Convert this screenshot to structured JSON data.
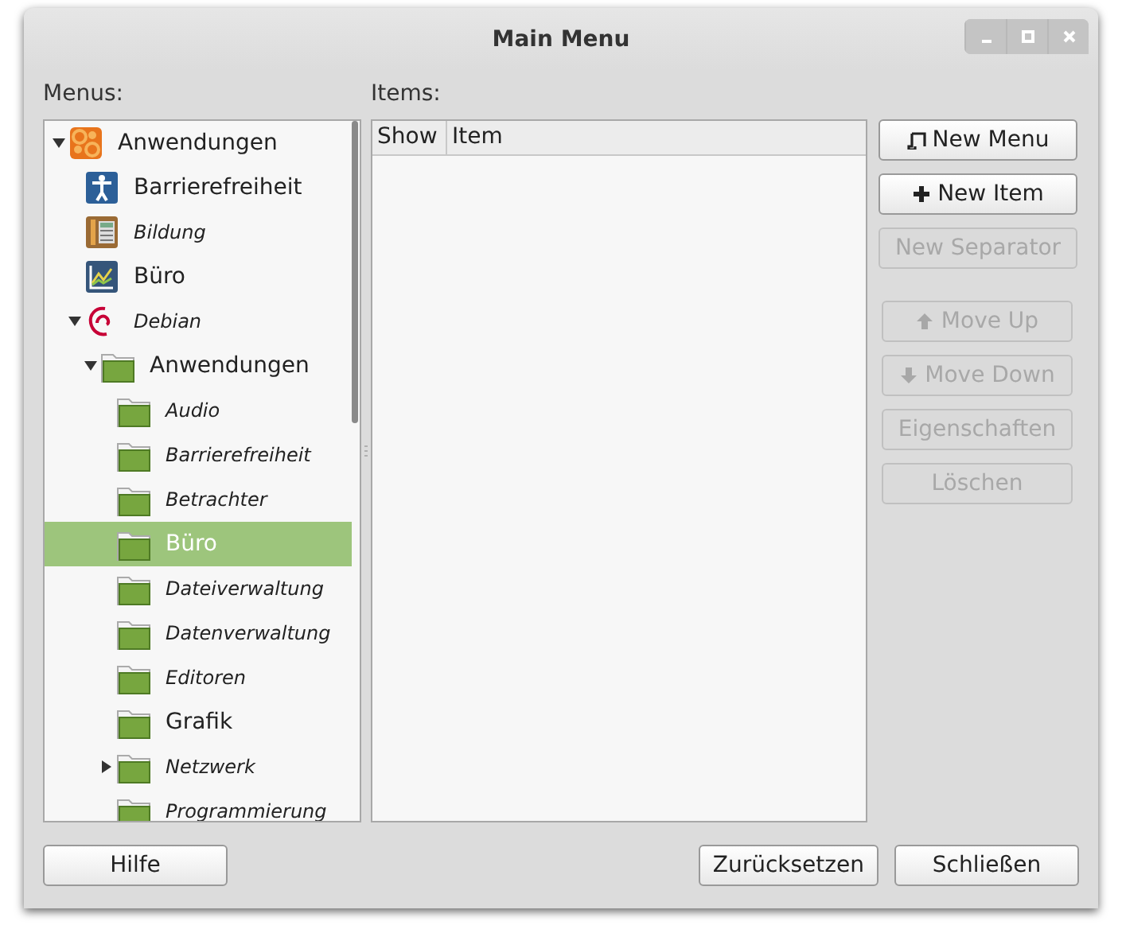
{
  "window": {
    "title": "Main Menu"
  },
  "menus": {
    "label": "Menus:",
    "tree": [
      {
        "label": "Anwendungen",
        "kind": "applications",
        "empty": false,
        "selected": false,
        "expanded": true,
        "children": [
          {
            "label": "Barrierefreiheit",
            "kind": "accessibility",
            "empty": false,
            "selected": false
          },
          {
            "label": "Bildung",
            "kind": "education",
            "empty": true,
            "selected": false
          },
          {
            "label": "Büro",
            "kind": "office",
            "empty": false,
            "selected": false
          },
          {
            "label": "Debian",
            "kind": "debian",
            "empty": true,
            "selected": false,
            "expanded": true,
            "children": [
              {
                "label": "Anwendungen",
                "kind": "folder",
                "empty": false,
                "selected": false,
                "expanded": true,
                "children": [
                  {
                    "label": "Audio",
                    "kind": "folder",
                    "empty": true,
                    "selected": false
                  },
                  {
                    "label": "Barrierefreiheit",
                    "kind": "folder",
                    "empty": true,
                    "selected": false
                  },
                  {
                    "label": "Betrachter",
                    "kind": "folder",
                    "empty": true,
                    "selected": false
                  },
                  {
                    "label": "Büro",
                    "kind": "folder",
                    "empty": false,
                    "selected": true
                  },
                  {
                    "label": "Dateiverwaltung",
                    "kind": "folder",
                    "empty": true,
                    "selected": false
                  },
                  {
                    "label": "Datenverwaltung",
                    "kind": "folder",
                    "empty": true,
                    "selected": false
                  },
                  {
                    "label": "Editoren",
                    "kind": "folder",
                    "empty": true,
                    "selected": false
                  },
                  {
                    "label": "Grafik",
                    "kind": "folder",
                    "empty": false,
                    "selected": false
                  },
                  {
                    "label": "Netzwerk",
                    "kind": "folder",
                    "empty": true,
                    "selected": false,
                    "expanded": false
                  },
                  {
                    "label": "Programmierung",
                    "kind": "folder",
                    "empty": true,
                    "selected": false
                  }
                ]
              }
            ]
          }
        ]
      }
    ]
  },
  "items": {
    "label": "Items:",
    "columns": [
      "Show",
      "Item"
    ]
  },
  "actions": [
    {
      "label": "New Menu",
      "kind": "menu",
      "disabled": false
    },
    {
      "label": "New Item",
      "kind": "plus",
      "disabled": false
    },
    {
      "label": "New Separator",
      "kind": "plain",
      "disabled": true
    },
    {
      "label": "Move Up",
      "kind": "up",
      "disabled": true
    },
    {
      "label": "Move Down",
      "kind": "down",
      "disabled": true
    },
    {
      "label": "Eigenschaften",
      "kind": "plain",
      "disabled": true
    },
    {
      "label": "Löschen",
      "kind": "plain",
      "disabled": true
    }
  ],
  "footer": {
    "left": [
      "Hilfe"
    ],
    "right": [
      "Zurücksetzen",
      "Schließen"
    ]
  }
}
